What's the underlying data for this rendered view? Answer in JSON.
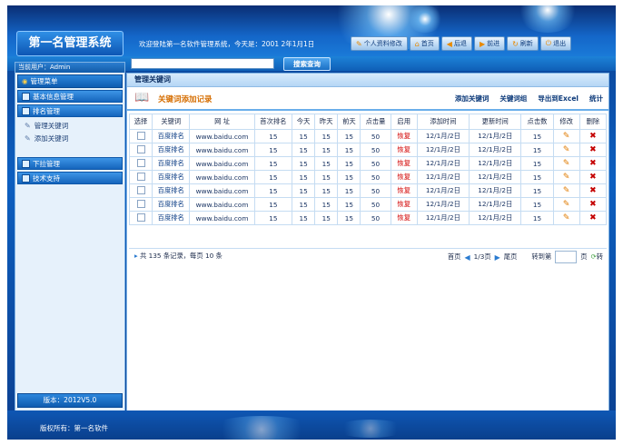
{
  "app": {
    "title": "第一名管理系统",
    "welcome": "欢迎登陆第一名软件管理系统，今天是：2001 2年1月1日"
  },
  "top_buttons": [
    {
      "label": "个人资料修改"
    },
    {
      "label": "首页"
    },
    {
      "label": "后退"
    },
    {
      "label": "前进"
    },
    {
      "label": "刷新"
    },
    {
      "label": "退出"
    }
  ],
  "search": {
    "placeholder": "",
    "value": "",
    "button": "搜索查询"
  },
  "sidebar": {
    "current_user": "当前用户：Admin",
    "menu_title": "管理菜单",
    "groups": [
      {
        "label": "基本信息管理"
      },
      {
        "label": "排名管理"
      },
      {
        "label": "下拉管理"
      },
      {
        "label": "技术支持"
      }
    ],
    "subitems": [
      {
        "label": "管理关键词"
      },
      {
        "label": "添加关键词"
      }
    ],
    "version": "版本：2012V5.0"
  },
  "main": {
    "title": "管理关键词",
    "subtitle": "关键词添加记录",
    "actions": [
      "添加关键词",
      "关键词组",
      "导出到Excel",
      "统计"
    ],
    "columns": [
      "选择",
      "关键词",
      "网 址",
      "首次排名",
      "今天",
      "昨天",
      "前天",
      "点击量",
      "启用",
      "添加时间",
      "更新时间",
      "点击数",
      "修改",
      "删除"
    ],
    "rows": [
      {
        "kw": "百度排名",
        "url": "www.baidu.com",
        "first": "15",
        "today": "15",
        "yesterday": "15",
        "before": "15",
        "clicks": "50",
        "status": "恢复",
        "added": "12/1月/2日",
        "updated": "12/1月/2日",
        "hits": "15"
      },
      {
        "kw": "百度排名",
        "url": "www.baidu.com",
        "first": "15",
        "today": "15",
        "yesterday": "15",
        "before": "15",
        "clicks": "50",
        "status": "恢复",
        "added": "12/1月/2日",
        "updated": "12/1月/2日",
        "hits": "15"
      },
      {
        "kw": "百度排名",
        "url": "www.baidu.com",
        "first": "15",
        "today": "15",
        "yesterday": "15",
        "before": "15",
        "clicks": "50",
        "status": "恢复",
        "added": "12/1月/2日",
        "updated": "12/1月/2日",
        "hits": "15"
      },
      {
        "kw": "百度排名",
        "url": "www.baidu.com",
        "first": "15",
        "today": "15",
        "yesterday": "15",
        "before": "15",
        "clicks": "50",
        "status": "恢复",
        "added": "12/1月/2日",
        "updated": "12/1月/2日",
        "hits": "15"
      },
      {
        "kw": "百度排名",
        "url": "www.baidu.com",
        "first": "15",
        "today": "15",
        "yesterday": "15",
        "before": "15",
        "clicks": "50",
        "status": "恢复",
        "added": "12/1月/2日",
        "updated": "12/1月/2日",
        "hits": "15"
      },
      {
        "kw": "百度排名",
        "url": "www.baidu.com",
        "first": "15",
        "today": "15",
        "yesterday": "15",
        "before": "15",
        "clicks": "50",
        "status": "恢复",
        "added": "12/1月/2日",
        "updated": "12/1月/2日",
        "hits": "15"
      },
      {
        "kw": "百度排名",
        "url": "www.baidu.com",
        "first": "15",
        "today": "15",
        "yesterday": "15",
        "before": "15",
        "clicks": "50",
        "status": "恢复",
        "added": "12/1月/2日",
        "updated": "12/1月/2日",
        "hits": "15"
      }
    ],
    "pager": {
      "info": "共 135 条记录，每页 10 条",
      "first": "首页",
      "page": "1/3页",
      "last": "尾页",
      "goto": "转到第",
      "page_unit": "页",
      "go": "转"
    }
  },
  "footer": {
    "copyright": "版权所有：第一名软件"
  }
}
